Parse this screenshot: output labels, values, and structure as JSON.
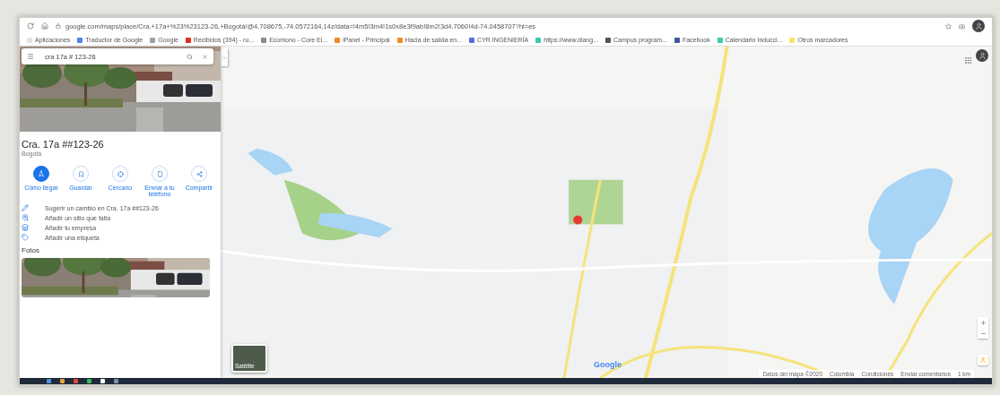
{
  "browser": {
    "address": "google.com/maps/place/Cra.+17a+%23%23123-26,+Bogotá/@4.708675,-74.0572164,14z/data=!4m5!3m4!1s0x8e3f9ab!8m2!3d4.7060!4d-74.0458707?hl=es",
    "bookmarks": [
      {
        "label": "Aplicaciones",
        "color": "#e2e2e2"
      },
      {
        "label": "Traductor de Google",
        "color": "#4a86e8"
      },
      {
        "label": "Google",
        "color": "#9aa0a6"
      },
      {
        "label": "Recibidos (394) - ru...",
        "color": "#d93025"
      },
      {
        "label": "Ecomono - Core El...",
        "color": "#8a8a8a"
      },
      {
        "label": "iPanel - Principal",
        "color": "#f08a24"
      },
      {
        "label": "Hacia de salida en...",
        "color": "#f08a24"
      },
      {
        "label": "CYR INGENIERÍA",
        "color": "#5a6fd6"
      },
      {
        "label": "https://www.diang...",
        "color": "#3cc8b4"
      },
      {
        "label": "Campus program...",
        "color": "#555555"
      },
      {
        "label": "Facebook",
        "color": "#3b5998"
      },
      {
        "label": "Calendario Inducci...",
        "color": "#3cc8b4"
      },
      {
        "label": "Otros marcadores",
        "color": "#f5e66a"
      }
    ]
  },
  "sidebar": {
    "search": {
      "value": "cra 17a # 123-26"
    },
    "title": "Cra. 17a ##123-26",
    "subtitle": "Bogotá",
    "actions": [
      {
        "label": "Cómo llegar",
        "kind": "directions",
        "selected": true
      },
      {
        "label": "Guardar",
        "kind": "save",
        "selected": false
      },
      {
        "label": "Cercano",
        "kind": "nearby",
        "selected": false
      },
      {
        "label": "Enviar a tu teléfono",
        "kind": "phone",
        "selected": false
      },
      {
        "label": "Compartir",
        "kind": "share",
        "selected": false
      }
    ],
    "links": [
      {
        "label": "Sugerir un cambio en Cra. 17a ##123-26",
        "kind": "edit"
      },
      {
        "label": "Añadir un sitio que falta",
        "kind": "add-place"
      },
      {
        "label": "Añadir tu empresa",
        "kind": "business"
      },
      {
        "label": "Añadir una etiqueta",
        "kind": "tag"
      }
    ],
    "photos_heading": "Fotos"
  },
  "map": {
    "kind": "picture",
    "satellite_label": "Satélite",
    "logo": "Google",
    "footer": [
      "Datos del mapa ©2020",
      "Colombia",
      "Condiciones",
      "Enviar comentarios",
      "1 km"
    ]
  }
}
